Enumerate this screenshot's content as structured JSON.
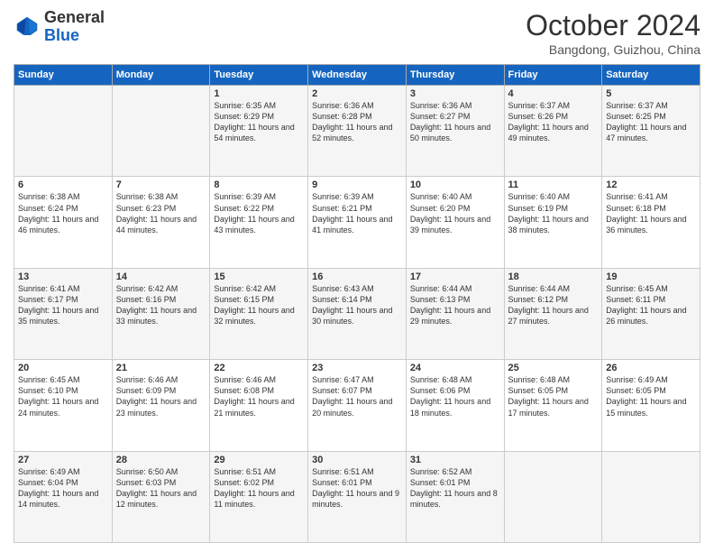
{
  "header": {
    "logo_general": "General",
    "logo_blue": "Blue",
    "month": "October 2024",
    "location": "Bangdong, Guizhou, China"
  },
  "days_of_week": [
    "Sunday",
    "Monday",
    "Tuesday",
    "Wednesday",
    "Thursday",
    "Friday",
    "Saturday"
  ],
  "weeks": [
    [
      {
        "day": "",
        "info": ""
      },
      {
        "day": "",
        "info": ""
      },
      {
        "day": "1",
        "info": "Sunrise: 6:35 AM\nSunset: 6:29 PM\nDaylight: 11 hours and 54 minutes."
      },
      {
        "day": "2",
        "info": "Sunrise: 6:36 AM\nSunset: 6:28 PM\nDaylight: 11 hours and 52 minutes."
      },
      {
        "day": "3",
        "info": "Sunrise: 6:36 AM\nSunset: 6:27 PM\nDaylight: 11 hours and 50 minutes."
      },
      {
        "day": "4",
        "info": "Sunrise: 6:37 AM\nSunset: 6:26 PM\nDaylight: 11 hours and 49 minutes."
      },
      {
        "day": "5",
        "info": "Sunrise: 6:37 AM\nSunset: 6:25 PM\nDaylight: 11 hours and 47 minutes."
      }
    ],
    [
      {
        "day": "6",
        "info": "Sunrise: 6:38 AM\nSunset: 6:24 PM\nDaylight: 11 hours and 46 minutes."
      },
      {
        "day": "7",
        "info": "Sunrise: 6:38 AM\nSunset: 6:23 PM\nDaylight: 11 hours and 44 minutes."
      },
      {
        "day": "8",
        "info": "Sunrise: 6:39 AM\nSunset: 6:22 PM\nDaylight: 11 hours and 43 minutes."
      },
      {
        "day": "9",
        "info": "Sunrise: 6:39 AM\nSunset: 6:21 PM\nDaylight: 11 hours and 41 minutes."
      },
      {
        "day": "10",
        "info": "Sunrise: 6:40 AM\nSunset: 6:20 PM\nDaylight: 11 hours and 39 minutes."
      },
      {
        "day": "11",
        "info": "Sunrise: 6:40 AM\nSunset: 6:19 PM\nDaylight: 11 hours and 38 minutes."
      },
      {
        "day": "12",
        "info": "Sunrise: 6:41 AM\nSunset: 6:18 PM\nDaylight: 11 hours and 36 minutes."
      }
    ],
    [
      {
        "day": "13",
        "info": "Sunrise: 6:41 AM\nSunset: 6:17 PM\nDaylight: 11 hours and 35 minutes."
      },
      {
        "day": "14",
        "info": "Sunrise: 6:42 AM\nSunset: 6:16 PM\nDaylight: 11 hours and 33 minutes."
      },
      {
        "day": "15",
        "info": "Sunrise: 6:42 AM\nSunset: 6:15 PM\nDaylight: 11 hours and 32 minutes."
      },
      {
        "day": "16",
        "info": "Sunrise: 6:43 AM\nSunset: 6:14 PM\nDaylight: 11 hours and 30 minutes."
      },
      {
        "day": "17",
        "info": "Sunrise: 6:44 AM\nSunset: 6:13 PM\nDaylight: 11 hours and 29 minutes."
      },
      {
        "day": "18",
        "info": "Sunrise: 6:44 AM\nSunset: 6:12 PM\nDaylight: 11 hours and 27 minutes."
      },
      {
        "day": "19",
        "info": "Sunrise: 6:45 AM\nSunset: 6:11 PM\nDaylight: 11 hours and 26 minutes."
      }
    ],
    [
      {
        "day": "20",
        "info": "Sunrise: 6:45 AM\nSunset: 6:10 PM\nDaylight: 11 hours and 24 minutes."
      },
      {
        "day": "21",
        "info": "Sunrise: 6:46 AM\nSunset: 6:09 PM\nDaylight: 11 hours and 23 minutes."
      },
      {
        "day": "22",
        "info": "Sunrise: 6:46 AM\nSunset: 6:08 PM\nDaylight: 11 hours and 21 minutes."
      },
      {
        "day": "23",
        "info": "Sunrise: 6:47 AM\nSunset: 6:07 PM\nDaylight: 11 hours and 20 minutes."
      },
      {
        "day": "24",
        "info": "Sunrise: 6:48 AM\nSunset: 6:06 PM\nDaylight: 11 hours and 18 minutes."
      },
      {
        "day": "25",
        "info": "Sunrise: 6:48 AM\nSunset: 6:05 PM\nDaylight: 11 hours and 17 minutes."
      },
      {
        "day": "26",
        "info": "Sunrise: 6:49 AM\nSunset: 6:05 PM\nDaylight: 11 hours and 15 minutes."
      }
    ],
    [
      {
        "day": "27",
        "info": "Sunrise: 6:49 AM\nSunset: 6:04 PM\nDaylight: 11 hours and 14 minutes."
      },
      {
        "day": "28",
        "info": "Sunrise: 6:50 AM\nSunset: 6:03 PM\nDaylight: 11 hours and 12 minutes."
      },
      {
        "day": "29",
        "info": "Sunrise: 6:51 AM\nSunset: 6:02 PM\nDaylight: 11 hours and 11 minutes."
      },
      {
        "day": "30",
        "info": "Sunrise: 6:51 AM\nSunset: 6:01 PM\nDaylight: 11 hours and 9 minutes."
      },
      {
        "day": "31",
        "info": "Sunrise: 6:52 AM\nSunset: 6:01 PM\nDaylight: 11 hours and 8 minutes."
      },
      {
        "day": "",
        "info": ""
      },
      {
        "day": "",
        "info": ""
      }
    ]
  ]
}
